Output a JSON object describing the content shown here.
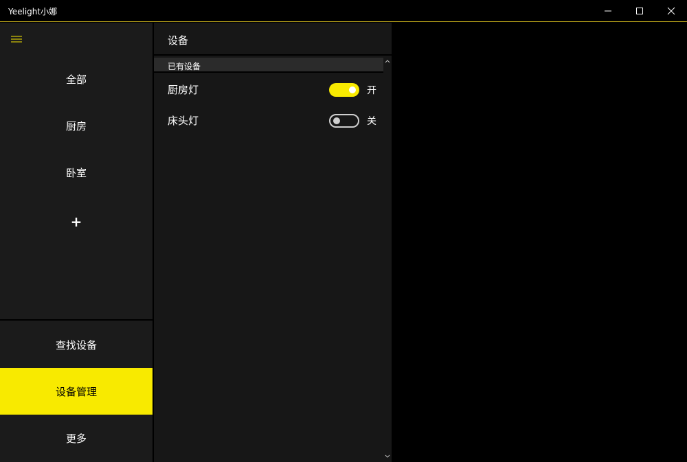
{
  "window": {
    "title": "Yeelight小娜",
    "accent_color": "#f8ea00",
    "controls": [
      "minimize",
      "maximize",
      "close"
    ]
  },
  "sidebar": {
    "menu_icon": "hamburger-icon",
    "groups": [
      {
        "label": "全部"
      },
      {
        "label": "厨房"
      },
      {
        "label": "卧室"
      },
      {
        "label": "+"
      }
    ],
    "nav": [
      {
        "label": "查找设备",
        "active": false
      },
      {
        "label": "设备管理",
        "active": true
      },
      {
        "label": "更多",
        "active": false
      }
    ]
  },
  "panel": {
    "title": "设备",
    "section": "已有设备",
    "devices": [
      {
        "name": "厨房灯",
        "on": true,
        "state_label": "开"
      },
      {
        "name": "床头灯",
        "on": false,
        "state_label": "关"
      }
    ]
  }
}
